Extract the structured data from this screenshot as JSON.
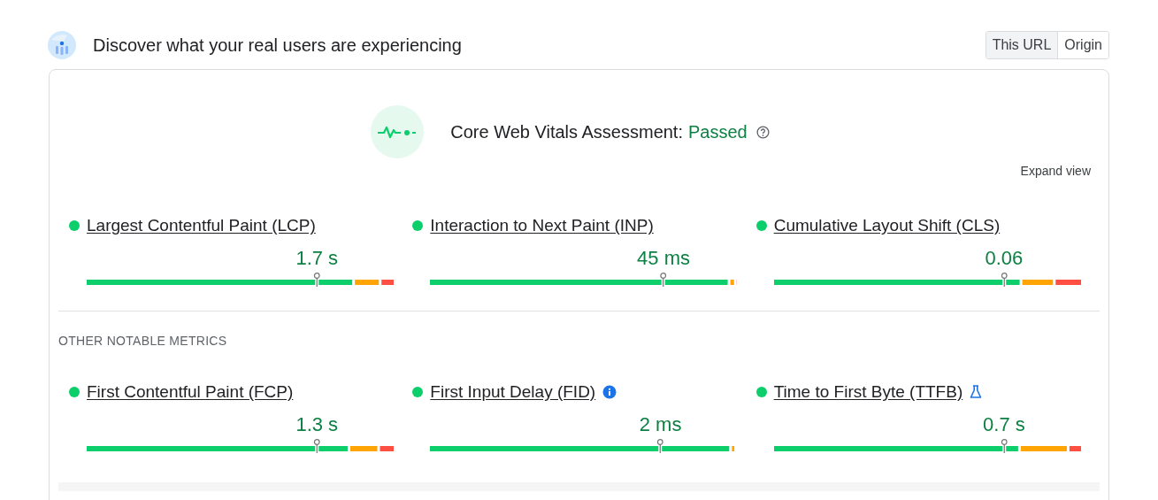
{
  "header": {
    "title": "Discover what your real users are experiencing"
  },
  "scope_toggle": [
    {
      "label": "This URL",
      "selected": true
    },
    {
      "label": "Origin",
      "selected": false
    }
  ],
  "assessment": {
    "label": "Core Web Vitals Assessment:",
    "result": "Passed"
  },
  "expand_link": "Expand view",
  "core_metrics": [
    {
      "name": "Largest Contentful Paint (LCP)",
      "color": "#0cce6b",
      "value": "1.7 s"
    },
    {
      "name": "Interaction to Next Paint (INP)",
      "color": "#0cce6b",
      "value": "45 ms"
    },
    {
      "name": "Cumulative Layout Shift (CLS)",
      "color": "#0cce6b",
      "value": "0.06"
    }
  ],
  "other_section": {
    "heading": "OTHER NOTABLE METRICS"
  },
  "other_metrics": [
    {
      "name": "First Contentful Paint (FCP)",
      "color": "#0cce6b",
      "value": "1.3 s"
    },
    {
      "name": "First Input Delay (FID)",
      "kind": "info",
      "color": "#0cce6b",
      "value": "2 ms"
    },
    {
      "name": "Time to First Byte (TTFB)",
      "kind": "lab",
      "color": "#0cce6b",
      "value": "0.7 s"
    }
  ]
}
